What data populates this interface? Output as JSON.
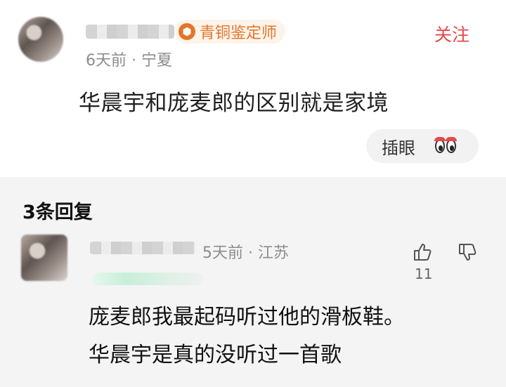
{
  "top_comment": {
    "badge": "青铜鉴定师",
    "meta": "6天前 · 宁夏",
    "follow_label": "关注",
    "content": "华晨宇和庞麦郎的区别就是家境",
    "action_label": "插眼",
    "action_icon": "eyes-icon"
  },
  "replies": {
    "header": "3条回复",
    "items": [
      {
        "meta": "5天前 · 江苏",
        "like_count": "11",
        "lines": [
          "庞麦郎我最起码听过他的滑板鞋。",
          "华晨宇是真的没听过一首歌"
        ]
      }
    ]
  },
  "colors": {
    "accent_red": "#e5484d",
    "badge_orange": "#e2762b",
    "reply_bg": "#f4f4f4",
    "muted": "#8c8c8c"
  }
}
